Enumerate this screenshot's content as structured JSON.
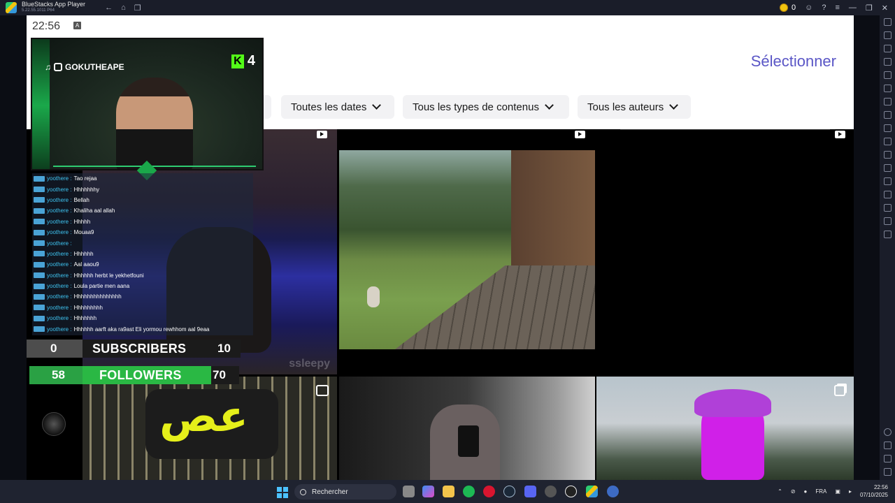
{
  "window": {
    "app_name": "BlueStacks App Player",
    "version": "5.22.55.1011 P64",
    "coin_count": "0"
  },
  "android": {
    "status_time": "22:56",
    "status_icon": "A",
    "select_label": "Sélectionner",
    "filters": [
      {
        "label": "Toutes les dates"
      },
      {
        "label": "Tous les types de contenus"
      },
      {
        "label": "Tous les auteurs"
      }
    ]
  },
  "overlay": {
    "handle": "GOKUTHEAPE",
    "kick_count": "4",
    "kick_letter": "K",
    "chat": [
      {
        "user": "yoothere :",
        "msg": "Tao rejaa"
      },
      {
        "user": "yoothere :",
        "msg": "Hhhhhhhy"
      },
      {
        "user": "yoothere :",
        "msg": "Bellah"
      },
      {
        "user": "yoothere :",
        "msg": "Khaliha aal allah"
      },
      {
        "user": "yoothere :",
        "msg": "Hhhhh"
      },
      {
        "user": "yoothere :",
        "msg": "Mouaa9"
      },
      {
        "user": "yoothere :",
        "msg": ""
      },
      {
        "user": "yoothere :",
        "msg": "Hhhhhh"
      },
      {
        "user": "yoothere :",
        "msg": "Aal aaou9"
      },
      {
        "user": "yoothere :",
        "msg": "Hhhhhh herbt le yekhetfouni"
      },
      {
        "user": "yoothere :",
        "msg": "Loula partie men aana"
      },
      {
        "user": "yoothere :",
        "msg": "Hhhhhhhhhhhhhhh"
      },
      {
        "user": "yoothere :",
        "msg": "Hhhhhhhhh"
      },
      {
        "user": "yoothere :",
        "msg": "Hhhhhhh"
      },
      {
        "user": "yoothere :",
        "msg": "Hhhhhh aarft aka ra9ast Eli yormou rewhhom aal 9eaa"
      }
    ],
    "subscribers": {
      "left": "0",
      "label": "SUBSCRIBERS",
      "right": "10"
    },
    "followers": {
      "left": "58",
      "label": "FOLLOWERS",
      "right": "70"
    }
  },
  "media": {
    "watermark": "ssleepy",
    "arabic_text": "عص"
  },
  "taskbar": {
    "search_placeholder": "Rechercher",
    "lang": "FRA",
    "time": "22:56",
    "date": "07/10/2025"
  },
  "colors": {
    "accent": "#5a56c6",
    "kick_green": "#53fc18",
    "followers_green": "#2ab844"
  }
}
